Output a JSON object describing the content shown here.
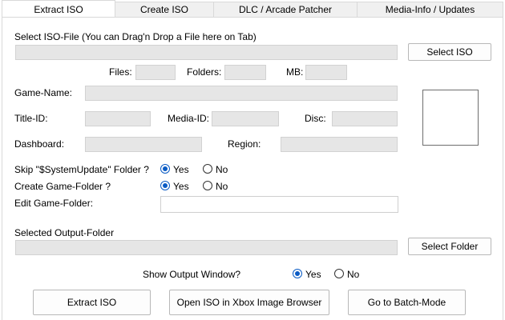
{
  "tabs": [
    {
      "label": "Extract ISO",
      "active": true
    },
    {
      "label": "Create ISO",
      "active": false
    },
    {
      "label": "DLC / Arcade Patcher",
      "active": false
    },
    {
      "label": "Media-Info / Updates",
      "active": false
    }
  ],
  "iso_file": {
    "label": "Select ISO-File (You can Drag'n Drop a File here on Tab)",
    "value": "",
    "button": "Select ISO"
  },
  "stats": {
    "files_label": "Files:",
    "files_value": "",
    "folders_label": "Folders:",
    "folders_value": "",
    "mb_label": "MB:",
    "mb_value": ""
  },
  "game_name": {
    "label": "Game-Name:",
    "value": ""
  },
  "ids": {
    "title_label": "Title-ID:",
    "title_value": "",
    "media_label": "Media-ID:",
    "media_value": "",
    "disc_label": "Disc:",
    "disc_value": ""
  },
  "dashboard": {
    "label": "Dashboard:",
    "value": "",
    "region_label": "Region:",
    "region_value": ""
  },
  "options": {
    "skip_update": {
      "label": "Skip \"$SystemUpdate\"  Folder ?",
      "yes": "Yes",
      "no": "No",
      "selected": "Yes"
    },
    "create_folder": {
      "label": "Create Game-Folder ?",
      "yes": "Yes",
      "no": "No",
      "selected": "Yes"
    },
    "edit_folder": {
      "label": "Edit Game-Folder:",
      "value": ""
    }
  },
  "output": {
    "label": "Selected Output-Folder",
    "value": "",
    "button": "Select Folder",
    "show_window": {
      "label": "Show Output Window?",
      "yes": "Yes",
      "no": "No",
      "selected": "Yes"
    }
  },
  "actions": {
    "extract": "Extract ISO",
    "open_browser": "Open ISO in  Xbox Image Browser",
    "batch": "Go to Batch-Mode"
  },
  "colors": {
    "accent": "#0a5bc4",
    "field_bg": "#e6e6e6"
  }
}
